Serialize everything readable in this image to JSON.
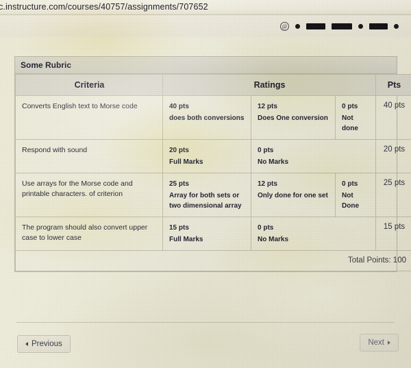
{
  "browser": {
    "url": "c.instructure.com/courses/40757/assignments/707652",
    "toolbar_icons": [
      {
        "name": "at-sign-icon",
        "type": "at"
      },
      {
        "name": "redacted-dot-1",
        "type": "dot"
      },
      {
        "name": "redacted-bar-1",
        "type": "bar",
        "width": "w1"
      },
      {
        "name": "redacted-bar-2",
        "type": "bar",
        "width": "w2"
      },
      {
        "name": "redacted-dot-2",
        "type": "dot"
      },
      {
        "name": "redacted-bar-3",
        "type": "bar",
        "width": "w3"
      },
      {
        "name": "redacted-dot-3",
        "type": "dot"
      }
    ]
  },
  "rubric": {
    "title": "Some Rubric",
    "columns": {
      "criteria": "Criteria",
      "ratings": "Ratings",
      "pts": "Pts"
    },
    "rows": [
      {
        "criterion": "Converts English text to Morse code",
        "ratings": [
          {
            "pts": "40 pts",
            "desc": "does both conversions"
          },
          {
            "pts": "12 pts",
            "desc": "Does One conversion"
          },
          {
            "pts": "0 pts",
            "desc": "Not done"
          }
        ],
        "points": "40 pts"
      },
      {
        "criterion": "Respond with sound",
        "ratings": [
          {
            "pts": "20 pts",
            "desc": "Full Marks"
          },
          {
            "pts": "0 pts",
            "desc": "No Marks"
          }
        ],
        "points": "20 pts"
      },
      {
        "criterion": "Use arrays for the Morse code and printable characters. of criterion",
        "ratings": [
          {
            "pts": "25 pts",
            "desc": "Array for both sets or two dimensional array"
          },
          {
            "pts": "12 pts",
            "desc": "Only done for one set"
          },
          {
            "pts": "0 pts",
            "desc": "Not Done"
          }
        ],
        "points": "25 pts"
      },
      {
        "criterion": "The program should also convert upper case to lower case",
        "ratings": [
          {
            "pts": "15 pts",
            "desc": "Full Marks"
          },
          {
            "pts": "0 pts",
            "desc": "No Marks"
          }
        ],
        "points": "15 pts"
      }
    ],
    "total": "Total Points: 100"
  },
  "nav": {
    "previous": "Previous",
    "next": "Next"
  }
}
